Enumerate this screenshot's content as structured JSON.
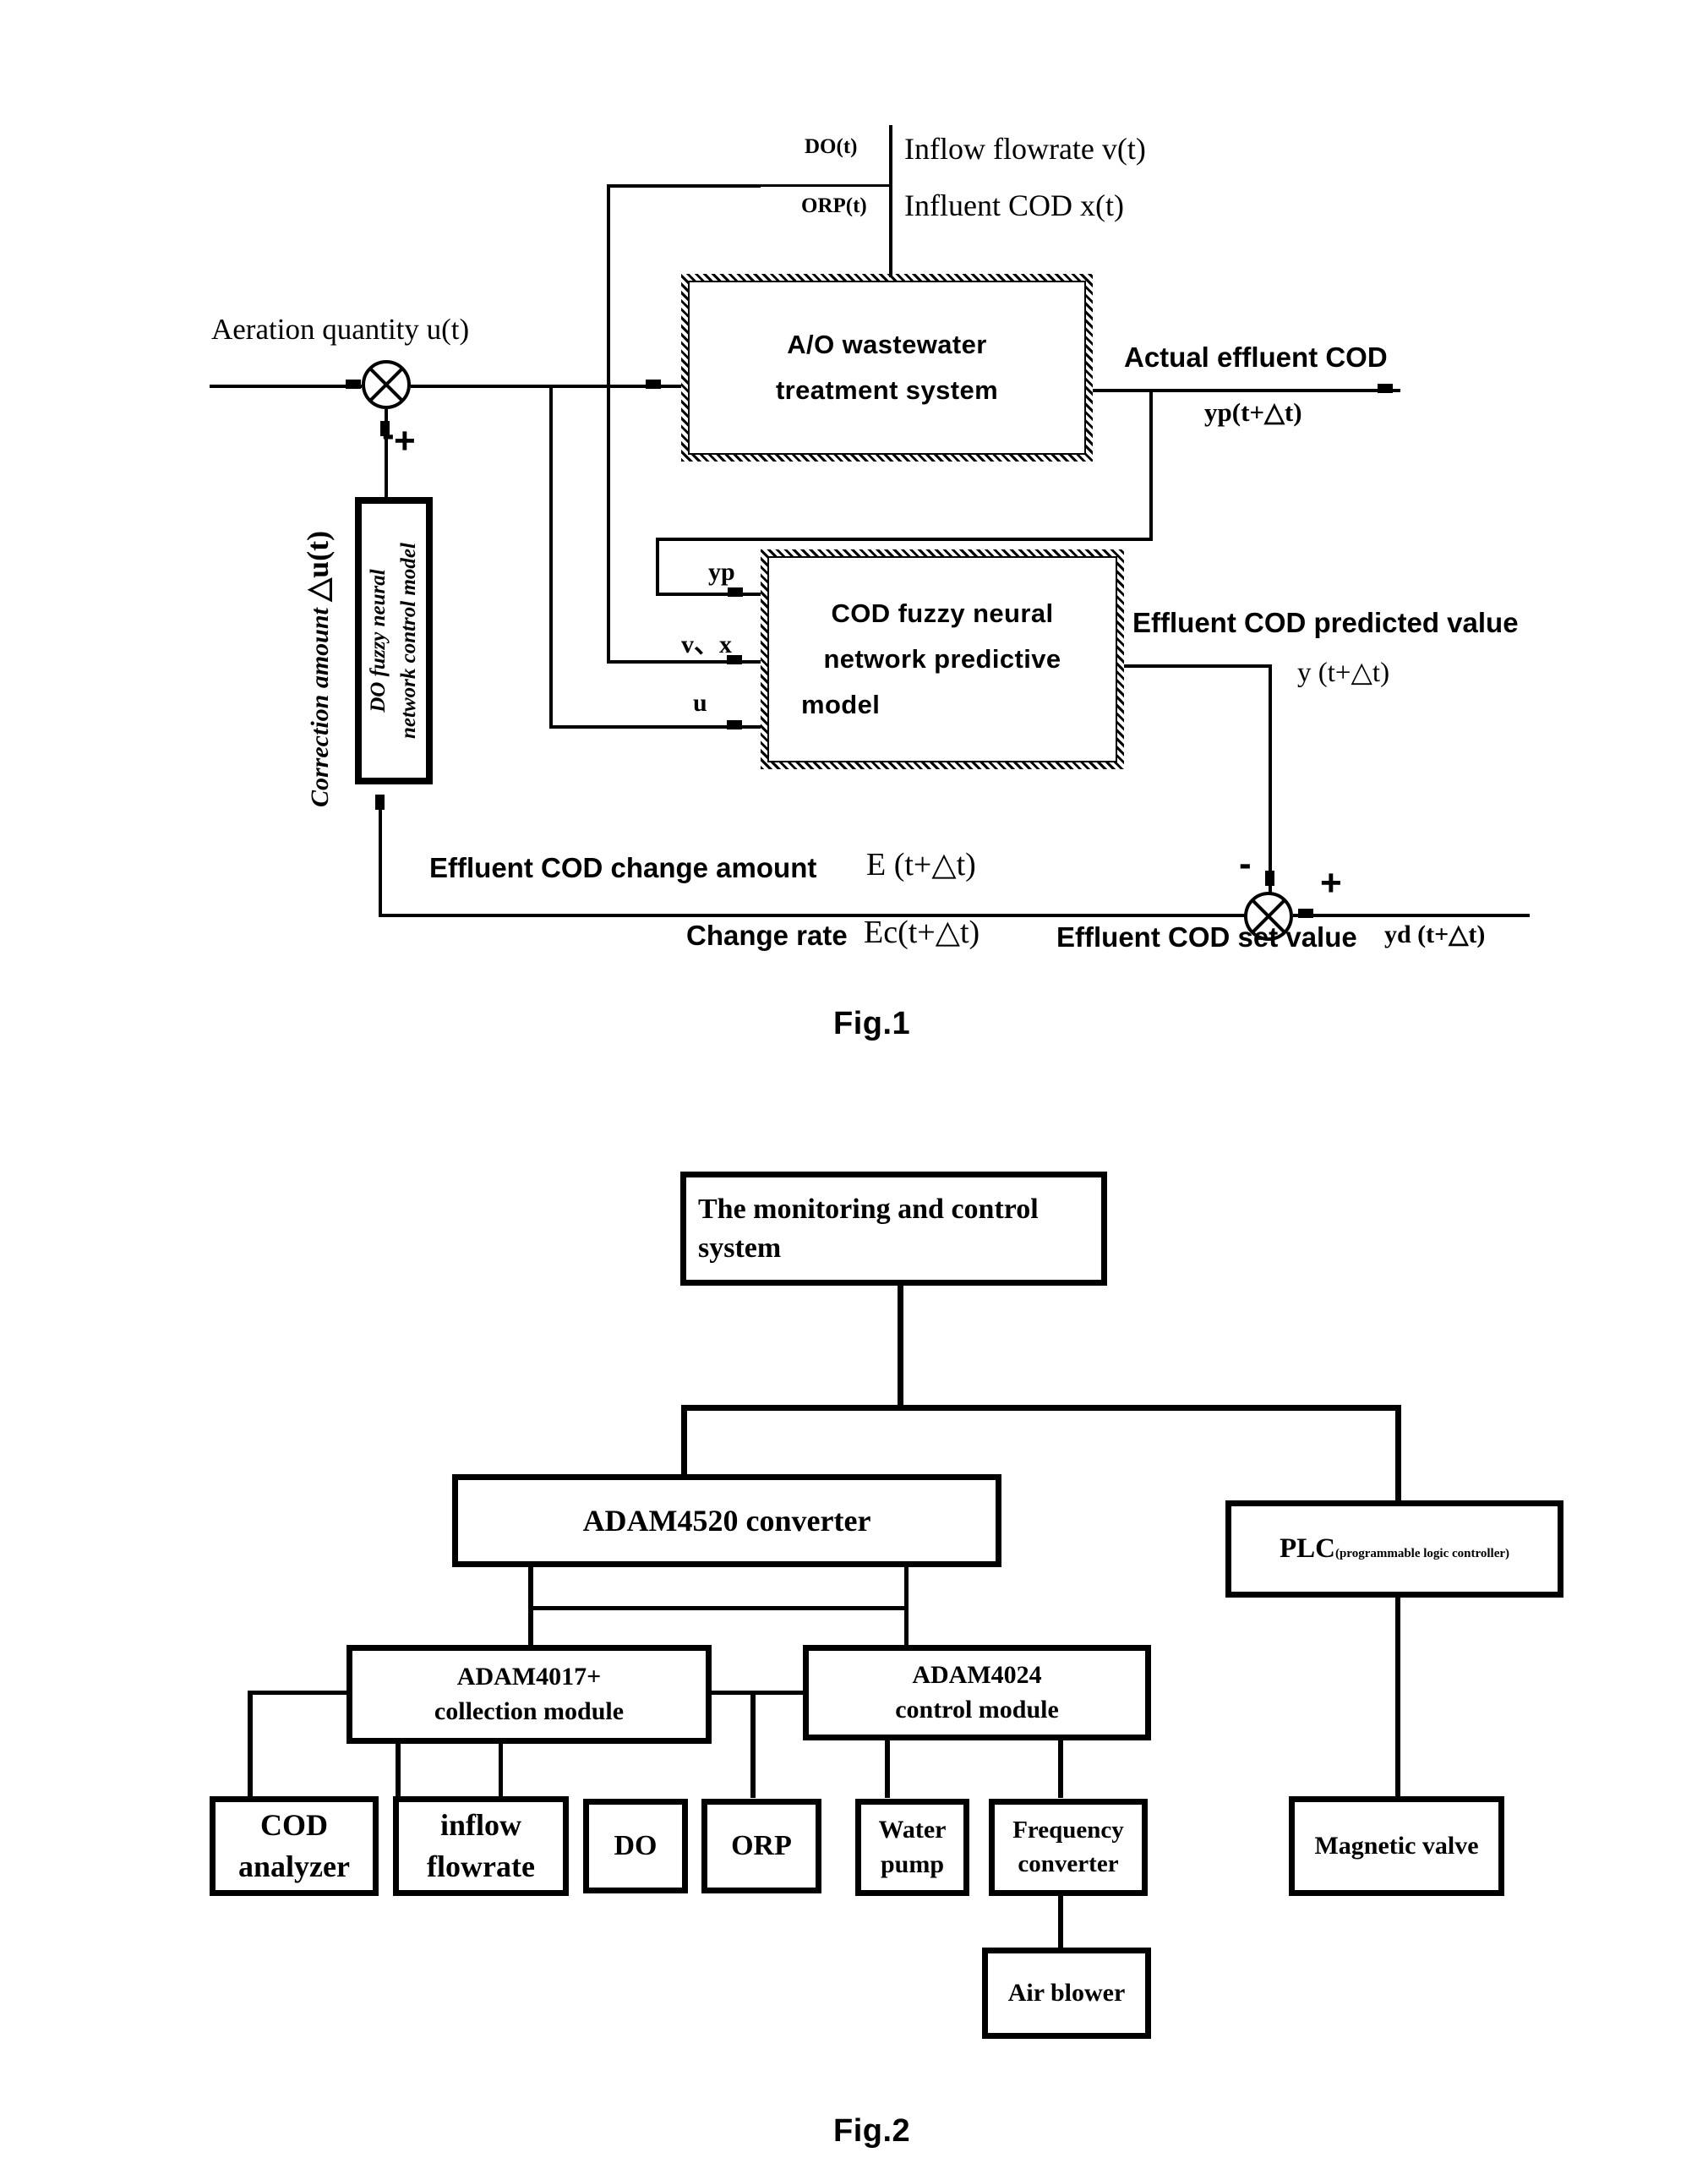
{
  "figures": [
    {
      "id": "fig1",
      "caption": "Fig.1",
      "labels": {
        "aeration_quantity": "Aeration quantity u(t)",
        "do_t": "DO(t)",
        "orp_t": "ORP(t)",
        "inflow_flowrate": "Inflow flowrate v(t)",
        "influent_cod": "Influent COD  x(t)",
        "actual_effluent_cod": "Actual effluent COD",
        "actual_effluent_cod_sym": "yp(t+△t)",
        "correction_amount": "Correction amount",
        "correction_amount_sym": "△u(t)",
        "input_yp": "yp",
        "input_vx": "v、x",
        "input_u": "u",
        "predicted_value": "Effluent COD predicted value",
        "predicted_value_sym": "y (t+△t)",
        "change_amount": "Effluent COD change amount",
        "change_amount_sym": "E (t+△t)",
        "change_rate": "Change rate",
        "change_rate_sym": "Ec(t+△t)",
        "set_value": "Effluent COD set value",
        "set_value_sym": "yd (t+△t)",
        "sign_minus": "-",
        "sign_plus": "+"
      },
      "blocks": {
        "ao_system_line1": "A/O wastewater",
        "ao_system_line2": "treatment system",
        "predictive_line1": "COD fuzzy neural",
        "predictive_line2": "network predictive",
        "predictive_line3": "model",
        "do_control_line1": "DO fuzzy neural",
        "do_control_line2": "network control model"
      }
    },
    {
      "id": "fig2",
      "caption": "Fig.2",
      "blocks": {
        "monitoring_system_line1": "The monitoring and control",
        "monitoring_system_line2": "system",
        "adam4520": "ADAM4520 converter",
        "plc_main": "PLC",
        "plc_sub": "(programmable logic controller)",
        "adam4017_line1": "ADAM4017+",
        "adam4017_line2": "collection module",
        "adam4024_line1": "ADAM4024",
        "adam4024_line2": "control module",
        "cod_analyzer_line1": "COD",
        "cod_analyzer_line2": "analyzer",
        "inflow_flowrate_line1": "inflow",
        "inflow_flowrate_line2": "flowrate",
        "do_sensor": "DO",
        "orp_sensor": "ORP",
        "water_pump_line1": "Water",
        "water_pump_line2": "pump",
        "frequency_converter_line1": "Frequency",
        "frequency_converter_line2": "converter",
        "air_blower": "Air blower",
        "magnetic_valve": "Magnetic valve"
      }
    }
  ],
  "colors": {
    "ink": "#000000",
    "paper": "#ffffff"
  }
}
